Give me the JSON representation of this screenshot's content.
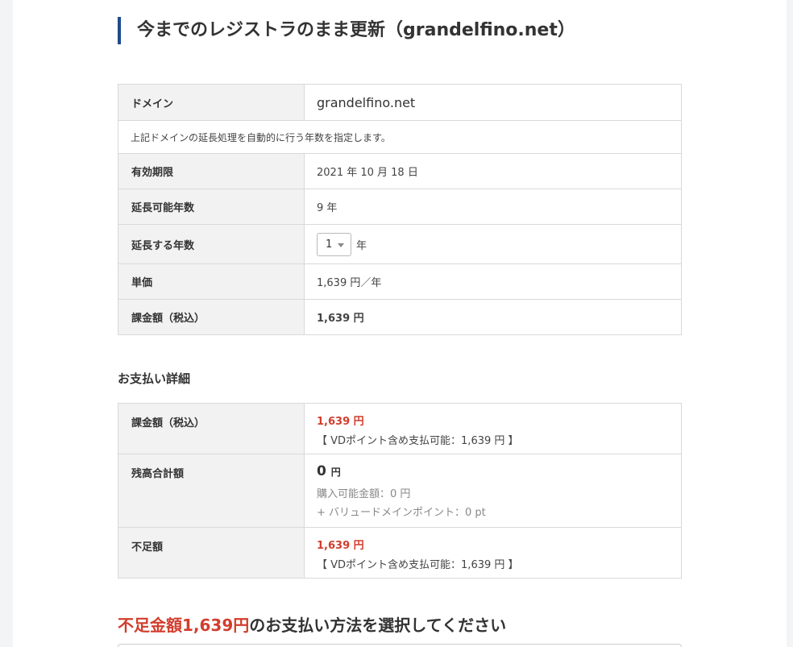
{
  "title": "今までのレジストラのまま更新（grandelfino.net）",
  "renewal": {
    "domain_label": "ドメイン",
    "domain_value": "grandelfino.net",
    "note": "上記ドメインの延長処理を自動的に行う年数を指定します。",
    "expiry_label": "有効期限",
    "expiry_value": "2021 年 10 月 18 日",
    "extendable_label": "延長可能年数",
    "extendable_value": "9 年",
    "years_label": "延長する年数",
    "years_selected": "1",
    "years_unit": "年",
    "unit_price_label": "単価",
    "unit_price_value": "1,639 円／年",
    "charge_label": "課金額（税込）",
    "charge_value": "1,639 円"
  },
  "payment": {
    "heading": "お支払い詳細",
    "charge_label": "課金額（税込）",
    "charge_value": "1,639 円",
    "charge_note": "【 VDポイント含め支払可能：1,639 円 】",
    "balance_label": "残高合計額",
    "balance_value": "0",
    "balance_unit": "円",
    "balance_purchasable": "購入可能金額：0 円",
    "balance_points": "+ バリュードメインポイント：0 pt",
    "shortfall_label": "不足額",
    "shortfall_value": "1,639 円",
    "shortfall_note": "【 VDポイント含め支払可能：1,639 円 】"
  },
  "select_method": {
    "accent": "不足金額1,639円",
    "rest": "のお支払い方法を選択してください"
  },
  "colors": {
    "accent_red": "#d23d2c",
    "heading_bar": "#1f4b8e"
  }
}
